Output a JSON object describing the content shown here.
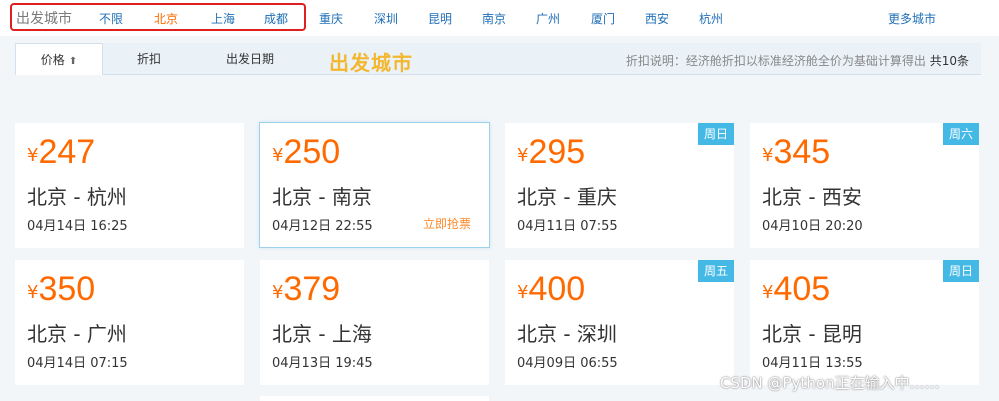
{
  "citybar": {
    "label": "出发城市",
    "cities": [
      "不限",
      "北京",
      "上海",
      "成都",
      "重庆",
      "深圳",
      "昆明",
      "南京",
      "广州",
      "厦门",
      "西安",
      "杭州"
    ],
    "active_city": "北京",
    "more": "更多城市"
  },
  "sortbar": {
    "tabs": [
      {
        "label": "价格",
        "arrow": "⬆"
      },
      {
        "label": "折扣",
        "arrow": ""
      },
      {
        "label": "出发日期",
        "arrow": ""
      }
    ],
    "overlay_title": "出发城市",
    "note": "折扣说明：经济舱折扣以标准经济舱全价为基础计算得出",
    "count": "共10条"
  },
  "currency_symbol": "¥",
  "cards": [
    {
      "price": "247",
      "route": "北京 - 杭州",
      "date": "04月14日 16:25",
      "badge": "",
      "buy": ""
    },
    {
      "price": "250",
      "route": "北京 - 南京",
      "date": "04月12日 22:55",
      "badge": "",
      "buy": "立即抢票"
    },
    {
      "price": "295",
      "route": "北京 - 重庆",
      "date": "04月11日 07:55",
      "badge": "周日",
      "buy": ""
    },
    {
      "price": "345",
      "route": "北京 - 西安",
      "date": "04月10日 20:20",
      "badge": "周六",
      "buy": ""
    },
    {
      "price": "350",
      "route": "北京 - 广州",
      "date": "04月14日 07:15",
      "badge": "",
      "buy": ""
    },
    {
      "price": "379",
      "route": "北京 - 上海",
      "date": "04月13日 19:45",
      "badge": "",
      "buy": ""
    },
    {
      "price": "400",
      "route": "北京 - 深圳",
      "date": "04月09日 06:55",
      "badge": "周五",
      "buy": ""
    },
    {
      "price": "405",
      "route": "北京 - 昆明",
      "date": "04月11日 13:55",
      "badge": "周日",
      "buy": ""
    }
  ],
  "watermark": "CSDN @Python正在输入中……",
  "colors": {
    "accent_orange": "#ff6a00",
    "link_blue": "#1f6fb7",
    "badge_blue": "#45b9e6",
    "highlight_red": "#e02020"
  }
}
